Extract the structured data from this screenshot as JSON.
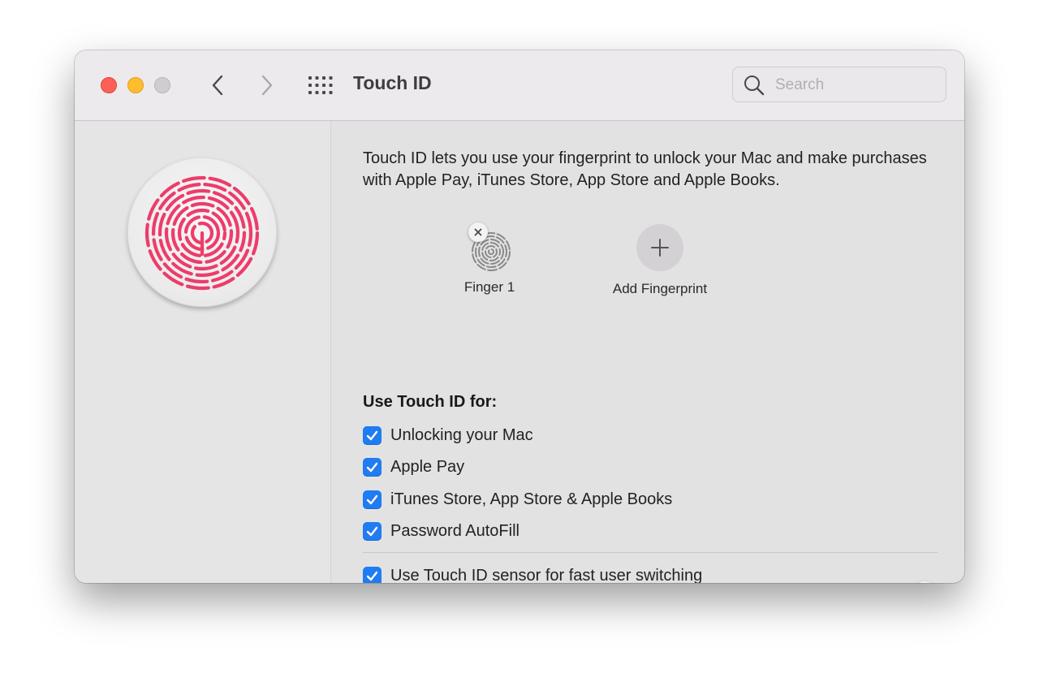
{
  "window": {
    "title": "Touch ID"
  },
  "toolbar": {
    "back_icon": "chevron-left-icon",
    "forward_icon": "chevron-right-icon",
    "show_all_icon": "grid-icon"
  },
  "search": {
    "placeholder": "Search",
    "value": ""
  },
  "main": {
    "description": "Touch ID lets you use your fingerprint to unlock your Mac and make purchases with Apple Pay, iTunes Store, App Store and Apple Books.",
    "fingerprints": [
      {
        "label": "Finger 1"
      }
    ],
    "add_fingerprint_label": "Add Fingerprint",
    "section_title": "Use Touch ID for:",
    "options": [
      {
        "label": "Unlocking your Mac",
        "checked": true
      },
      {
        "label": "Apple Pay",
        "checked": true
      },
      {
        "label": "iTunes Store, App Store & Apple Books",
        "checked": true
      },
      {
        "label": "Password AutoFill",
        "checked": true
      }
    ],
    "fast_switching": {
      "label": "Use Touch ID sensor for fast user switching",
      "checked": true
    },
    "help_label": "?"
  },
  "colors": {
    "accent": "#1f7cf2",
    "fingerprint": "#ec3d69",
    "close": "#fe5f57",
    "minimize": "#febc2e",
    "maximize_disabled": "#cfcdcf"
  }
}
